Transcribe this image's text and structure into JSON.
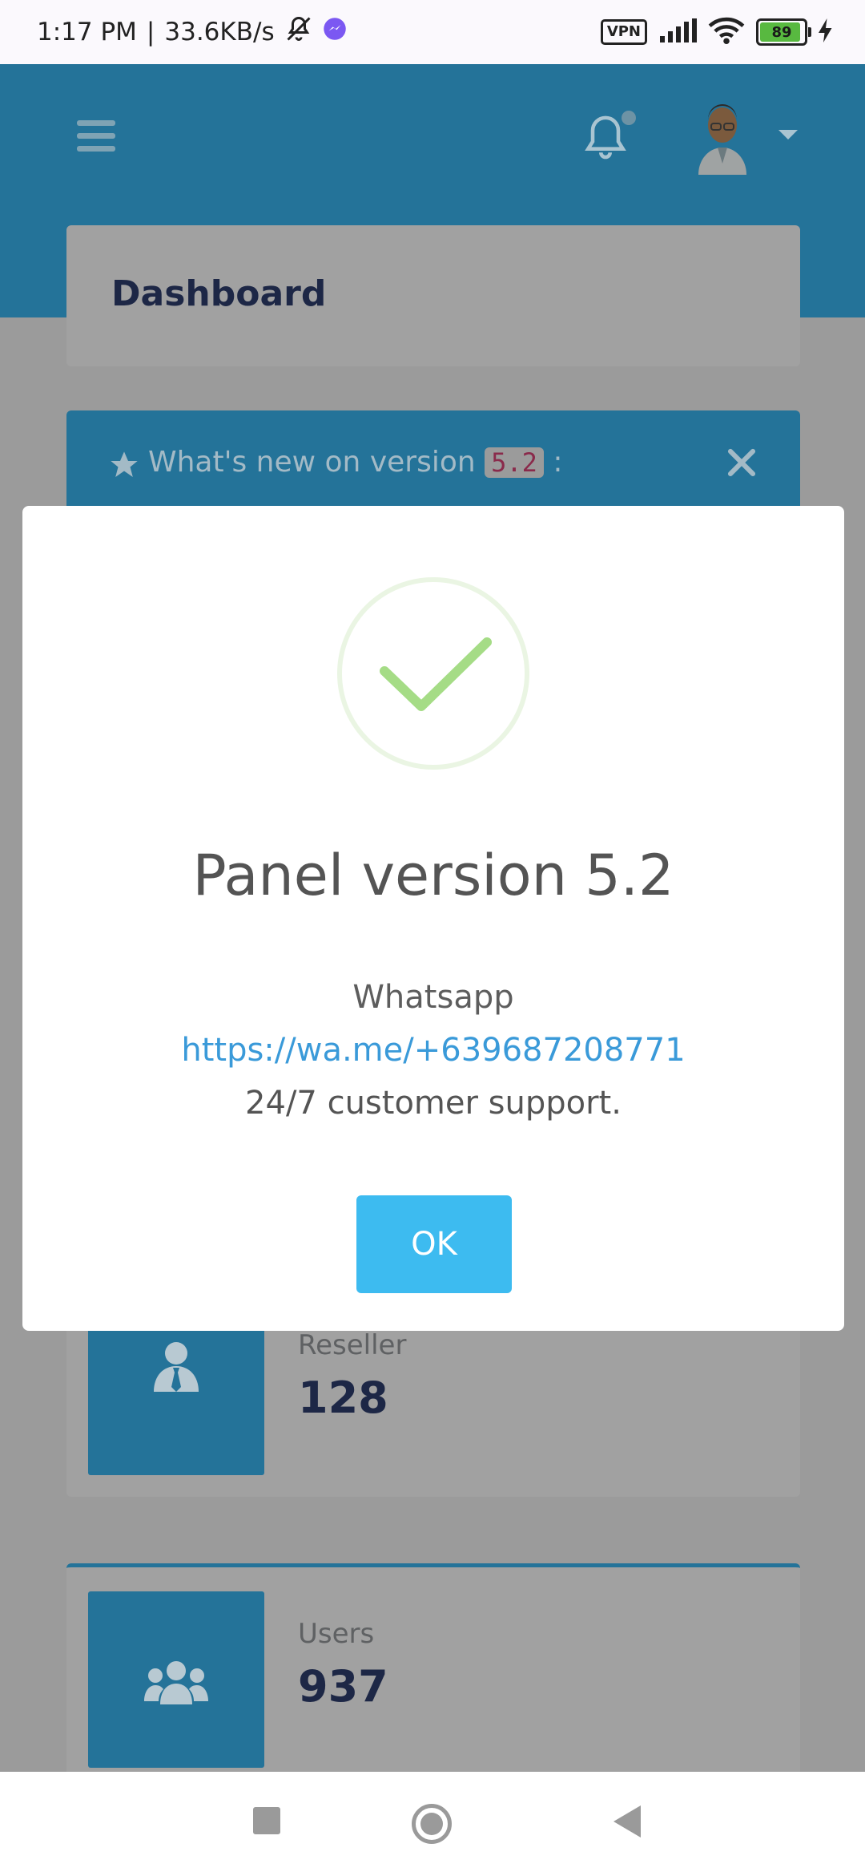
{
  "status_bar": {
    "time": "1:17 PM",
    "separator": "|",
    "speed": "33.6KB/s",
    "vpn": "VPN",
    "battery_level": "89"
  },
  "header": {
    "page_title": "Dashboard"
  },
  "whats_new": {
    "prefix": "What's new on version",
    "version": "5.2",
    "suffix": ":"
  },
  "modal": {
    "title": "Panel version 5.2",
    "line1": "Whatsapp",
    "link": "https://wa.me/+639687208771",
    "line3": "24/7 customer support.",
    "ok_label": "OK"
  },
  "stats": [
    {
      "label": "Reseller",
      "value": "128"
    },
    {
      "label": "Users",
      "value": "937"
    }
  ],
  "colors": {
    "primary": "#247399",
    "accent": "#3dbbf0",
    "success": "#a5dc86",
    "link": "#3a9ad9"
  }
}
